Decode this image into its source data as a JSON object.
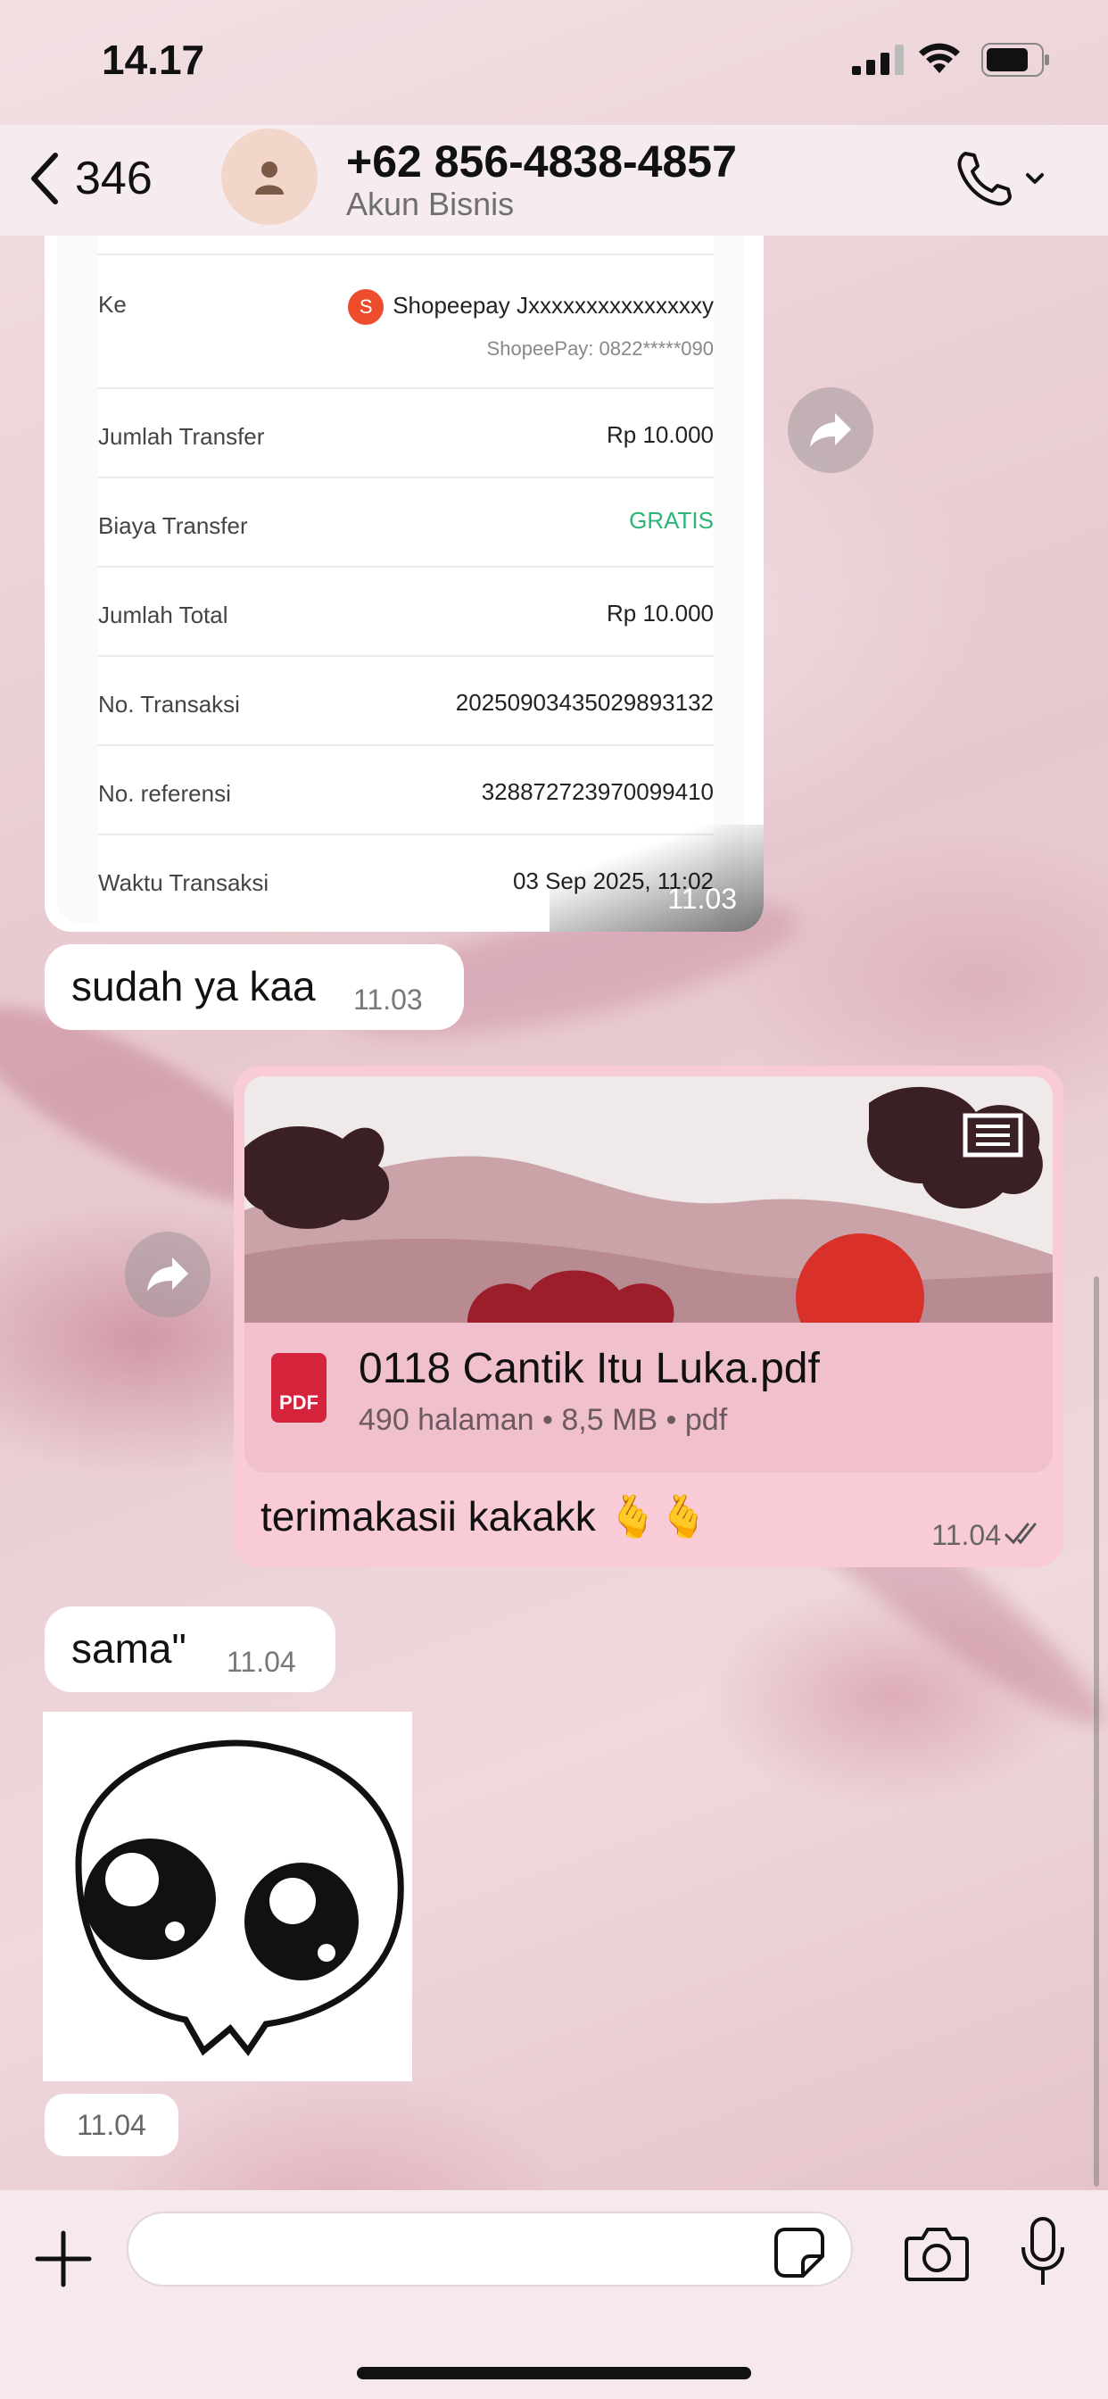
{
  "status_bar": {
    "time": "14.17"
  },
  "header": {
    "back_count": "346",
    "contact_name": "+62 856-4838-4857",
    "contact_subtitle": "Akun Bisnis"
  },
  "receipt": {
    "rows": [
      {
        "label": "Ke",
        "value": "Shopeepay Jxxxxxxxxxxxxxxxy",
        "sub": "ShopeePay: 0822*****090"
      },
      {
        "label": "Jumlah Transfer",
        "value": "Rp 10.000"
      },
      {
        "label": "Biaya Transfer",
        "value": "GRATIS"
      },
      {
        "label": "Jumlah Total",
        "value": "Rp 10.000"
      },
      {
        "label": "No. Transaksi",
        "value": "20250903435029893132"
      },
      {
        "label": "No. referensi",
        "value": "328872723970099410"
      },
      {
        "label": "Waktu Transaksi",
        "value": "03 Sep 2025, 11:02"
      }
    ],
    "time": "11.03",
    "free_color": "#2bb673"
  },
  "messages": {
    "in_1": {
      "text": "sudah ya kaa",
      "time": "11.03"
    },
    "out_pdf": {
      "file_name": "0118 Cantik Itu Luka.pdf",
      "meta": "490 halaman • 8,5 MB • pdf",
      "text": "terimakasii kakakk 🫰🫰",
      "time": "11.04"
    },
    "in_2": {
      "text": "sama\"",
      "time": "11.04"
    },
    "sticker_time": "11.04"
  },
  "composer": {
    "placeholder": ""
  },
  "colors": {
    "outgoing_bubble": "#f9cbd6",
    "incoming_bubble": "#ffffff",
    "pdf_red": "#d6233c"
  }
}
